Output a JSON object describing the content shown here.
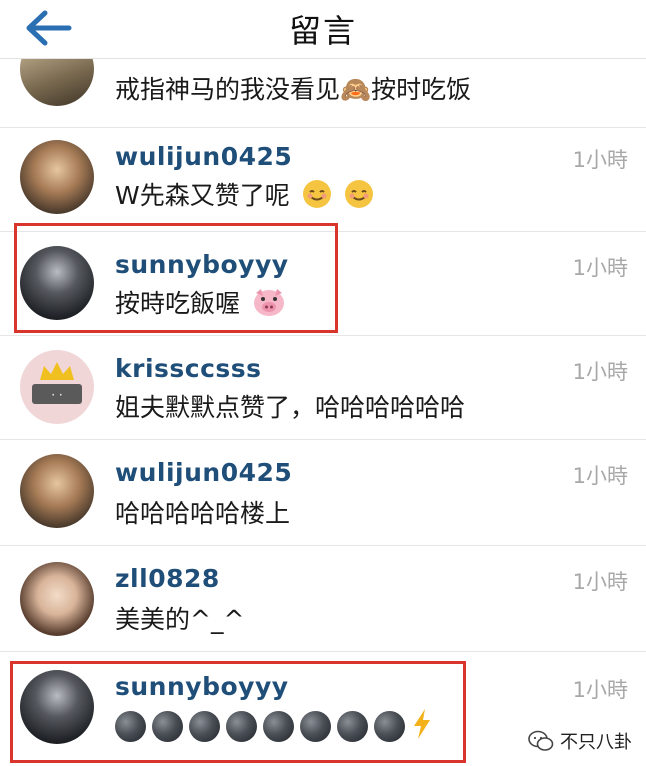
{
  "header": {
    "title": "留言"
  },
  "comments": [
    {
      "username": "",
      "text": "戒指神马的我没看见🙈按时吃饭",
      "time": ""
    },
    {
      "username": "wulijun0425",
      "text": "W先森又赞了呢",
      "time": "1小時"
    },
    {
      "username": "sunnyboyyy",
      "text": "按時吃飯喔",
      "time": "1小時"
    },
    {
      "username": "krissccsss",
      "text": "姐夫默默点赞了，哈哈哈哈哈哈",
      "time": "1小時"
    },
    {
      "username": "wulijun0425",
      "text": "哈哈哈哈哈楼上",
      "time": "1小時"
    },
    {
      "username": "zll0828",
      "text": "美美的^_^",
      "time": "1小時"
    },
    {
      "username": "sunnyboyyy",
      "text": "",
      "time": "1小時"
    }
  ],
  "watermark": {
    "text": "不只八卦"
  },
  "colors": {
    "username": "#1f4e79",
    "highlight": "#d9352c",
    "time": "#a8a8a8"
  }
}
